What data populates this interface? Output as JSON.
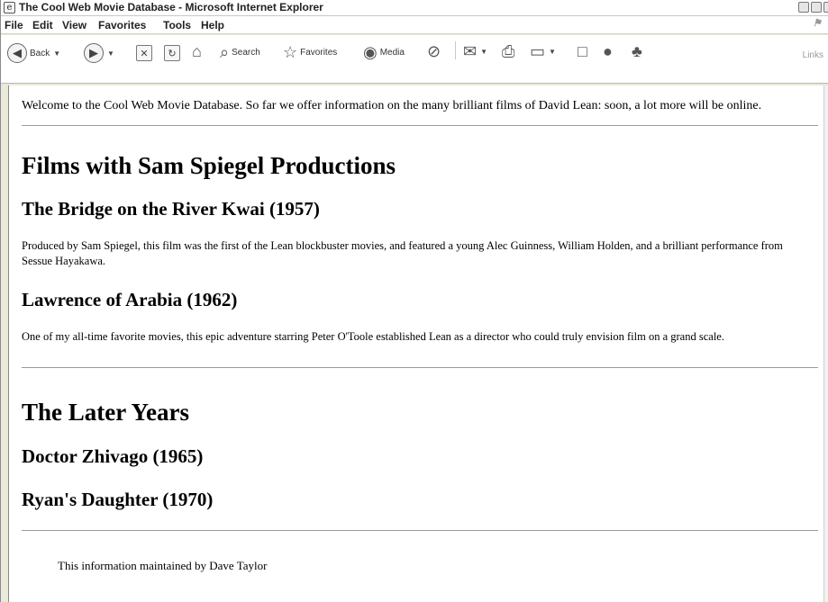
{
  "window": {
    "title": "The Cool Web Movie Database - Microsoft Internet Explorer"
  },
  "menu": [
    "File",
    "Edit",
    "View",
    "Favorites",
    "Tools",
    "Help"
  ],
  "toolbar": {
    "back_label": "Back",
    "search_label": "Search",
    "favorites_label": "Favorites",
    "media_label": "Media",
    "links_label": "Links",
    "icons": [
      "back-icon",
      "forward-icon",
      "stop-icon",
      "refresh-icon",
      "home-icon",
      "search-icon",
      "favorites-star-icon",
      "media-icon",
      "history-icon",
      "mail-icon",
      "print-icon",
      "edit-icon",
      "discuss-icon",
      "messenger-icon",
      "research-icon"
    ]
  },
  "page": {
    "welcome": "Welcome to the Cool Web Movie Database. So far we offer information on the many brilliant films of David Lean: soon, a lot more will be online.",
    "section1": {
      "heading": "Films with Sam Spiegel Productions",
      "films": [
        {
          "title": "The Bridge on the River Kwai (1957)",
          "description": "Produced by Sam Spiegel, this film was the first of the Lean blockbuster movies, and featured a young Alec Guinness, William Holden, and a brilliant performance from Sessue Hayakawa."
        },
        {
          "title": "Lawrence of Arabia (1962)",
          "description": "One of my all-time favorite movies, this epic adventure starring Peter O'Toole established Lean as a director who could truly envision film on a grand scale."
        }
      ]
    },
    "section2": {
      "heading": "The Later Years",
      "films": [
        {
          "title": "Doctor Zhivago (1965)"
        },
        {
          "title": "Ryan's Daughter (1970)"
        }
      ]
    },
    "footer": "This information maintained by Dave Taylor"
  }
}
